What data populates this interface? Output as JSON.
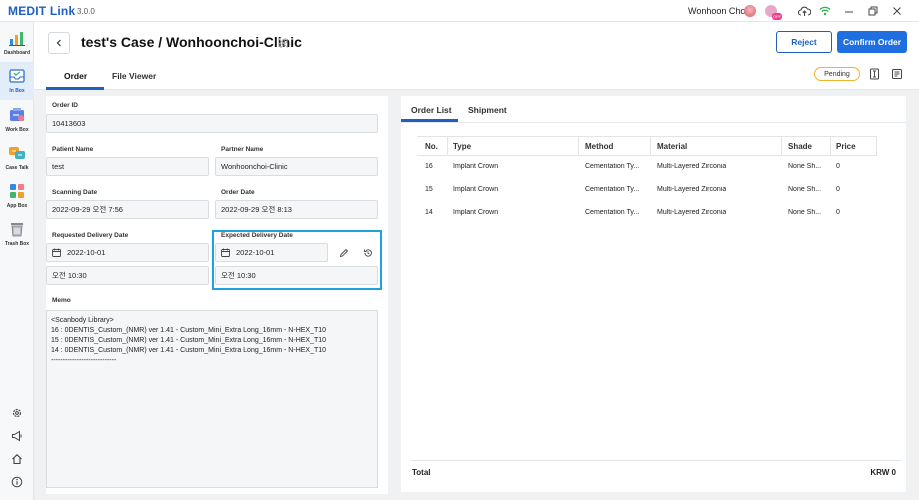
{
  "app": {
    "brand": "MEDIT Link",
    "version": "3.0.0",
    "user_name": "Wonhoon Choi",
    "avatar_badge": "OFF"
  },
  "nav": {
    "items": [
      {
        "label": "Dashboard",
        "icon": "bar-chart-icon"
      },
      {
        "label": "In Box",
        "icon": "inbox-icon",
        "active": true
      },
      {
        "label": "Work Box",
        "icon": "workbox-icon"
      },
      {
        "label": "Case Talk",
        "icon": "case-talk-icon"
      },
      {
        "label": "App Box",
        "icon": "app-box-icon"
      },
      {
        "label": "Trash Box",
        "icon": "trash-icon"
      }
    ],
    "bottom_icons": [
      "settings-icon",
      "megaphone-icon",
      "home-icon",
      "info-icon"
    ]
  },
  "header": {
    "title": "test's Case / Wonhoonchoi-Clinic",
    "reject_label": "Reject",
    "confirm_label": "Confirm Order",
    "tabs": [
      {
        "label": "Order",
        "active": true
      },
      {
        "label": "File Viewer",
        "active": false
      }
    ],
    "status": "Pending"
  },
  "order": {
    "order_id_label": "Order ID",
    "order_id": "10413603",
    "patient_name_label": "Patient Name",
    "patient_name": "test",
    "partner_name_label": "Partner Name",
    "partner_name": "Wonhoonchoi-Clinic",
    "scanning_date_label": "Scanning Date",
    "scanning_date": "2022-09-29 오전 7:56",
    "order_date_label": "Order Date",
    "order_date": "2022-09-29 오전 8:13",
    "requested_delivery_label": "Requested Delivery Date",
    "requested_delivery_date": "2022-10-01",
    "requested_delivery_time": "오전 10:30",
    "expected_delivery_label": "Expected Delivery Date",
    "expected_delivery_date": "2022-10-01",
    "expected_delivery_time": "오전 10:30",
    "memo_label": "Memo",
    "memo_lines": [
      "<Scanbody Library>",
      "16 : 0DENTIS_Custom_(NMR) ver 1.41 - Custom_Mini_Extra Long_16mm - N-HEX_T10",
      "15 : 0DENTIS_Custom_(NMR) ver 1.41 - Custom_Mini_Extra Long_16mm - N-HEX_T10",
      "14 : 0DENTIS_Custom_(NMR) ver 1.41 - Custom_Mini_Extra Long_16mm - N-HEX_T10",
      "----------------------------"
    ]
  },
  "order_list": {
    "tabs": [
      {
        "label": "Order List",
        "active": true
      },
      {
        "label": "Shipment",
        "active": false
      }
    ],
    "columns": [
      "No.",
      "Type",
      "Method",
      "Material",
      "Shade",
      "Price"
    ],
    "rows": [
      {
        "no": "16",
        "type": "Implant Crown",
        "method": "Cementation Ty...",
        "material": "Multi-Layered Zirconia",
        "shade": "None Sh...",
        "price": "0"
      },
      {
        "no": "15",
        "type": "Implant Crown",
        "method": "Cementation Ty...",
        "material": "Multi-Layered Zirconia",
        "shade": "None Sh...",
        "price": "0"
      },
      {
        "no": "14",
        "type": "Implant Crown",
        "method": "Cementation Ty...",
        "material": "Multi-Layered Zirconia",
        "shade": "None Sh...",
        "price": "0"
      }
    ],
    "total_label": "Total",
    "total_value": "KRW  0"
  },
  "colors": {
    "accent": "#1f5fc2",
    "confirm": "#1f6fe0",
    "highlight": "#1fa2e0",
    "pending_border": "#f0b429"
  }
}
